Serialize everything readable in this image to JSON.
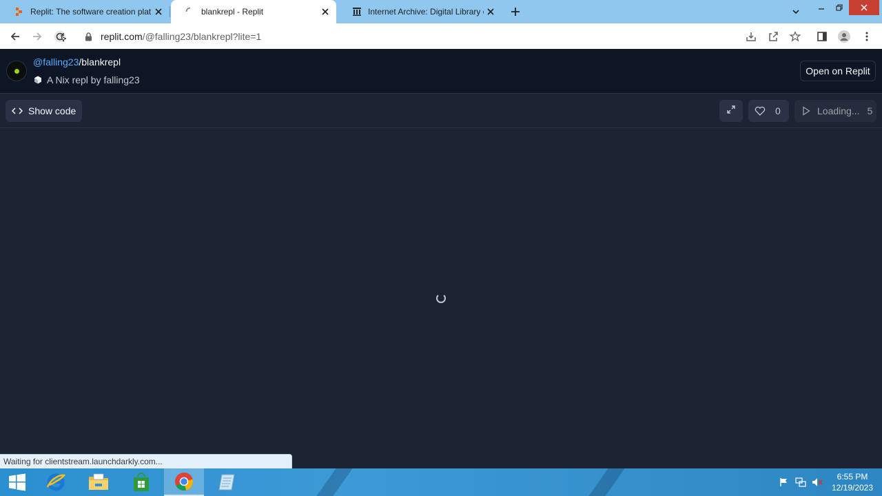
{
  "browser": {
    "tabs": [
      {
        "title": "Replit: The software creation plat",
        "favicon": "replit-favicon",
        "active": false
      },
      {
        "title": "blankrepl - Replit",
        "favicon": "loading-spinner-icon",
        "active": true
      },
      {
        "title": "Internet Archive: Digital Library o",
        "favicon": "internet-archive-favicon",
        "active": false
      }
    ],
    "url_host": "replit.com",
    "url_path": "/@falling23/blankrepl?lite=1",
    "status_text": "Waiting for clientstream.launchdarkly.com..."
  },
  "repl": {
    "owner": "@falling23",
    "separator": "/",
    "name": "blankrepl",
    "description": "A Nix repl by falling23",
    "open_button": "Open on Replit",
    "show_code": "Show code",
    "likes": "0",
    "run_label": "Loading...",
    "run_count": "5"
  },
  "taskbar": {
    "time": "6:55 PM",
    "date": "12/19/2023",
    "apps": [
      "windows-start",
      "internet-explorer",
      "file-explorer",
      "store",
      "chrome",
      "notepad"
    ]
  },
  "colors": {
    "replit_bg": "#0e1525",
    "replit_surface": "#1c2333",
    "replit_link": "#57abff",
    "tabstrip": "#8fc7ee",
    "close_red": "#c84031"
  }
}
